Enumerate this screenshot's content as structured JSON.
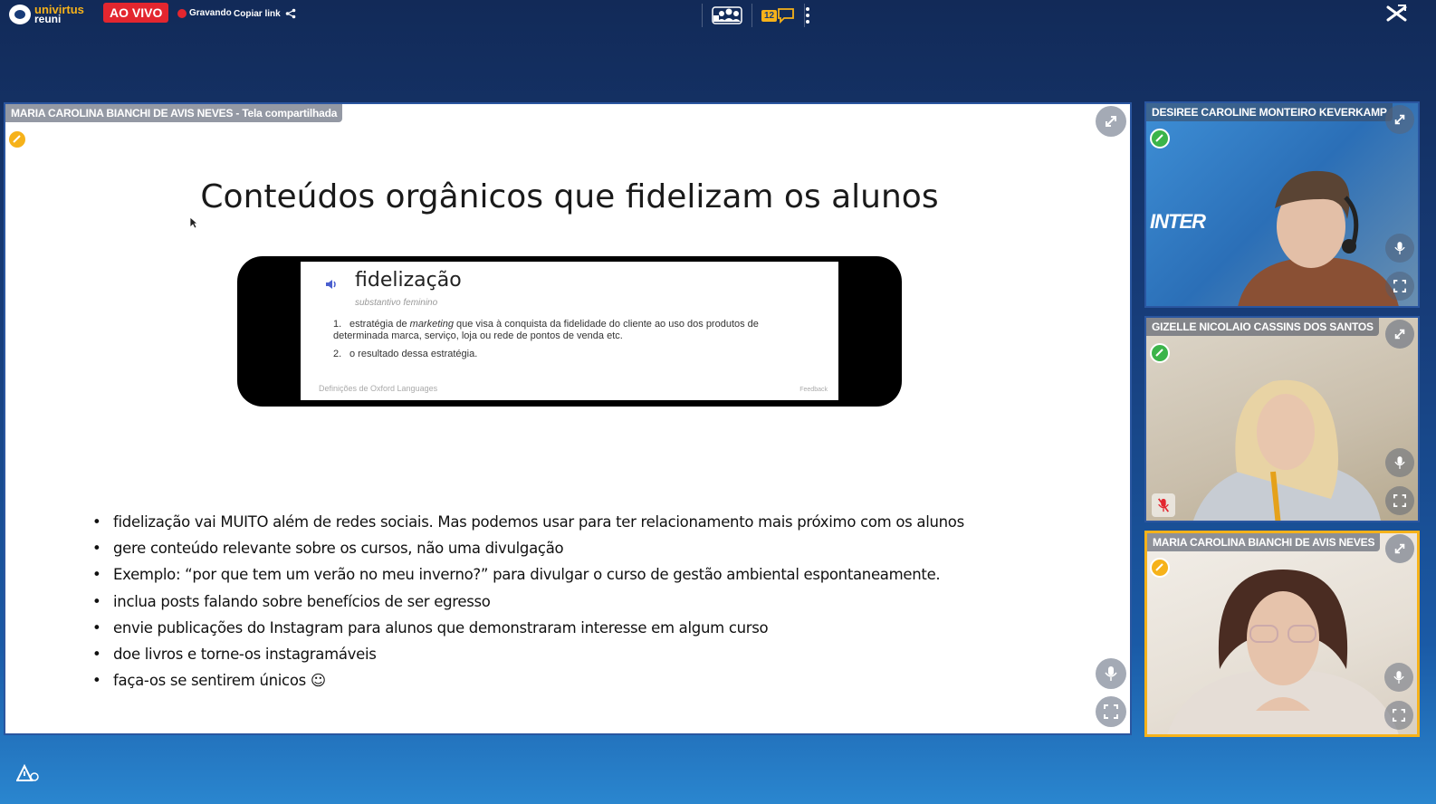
{
  "app": {
    "logo_line1": "univirtus",
    "logo_line2": "reuni",
    "live_label": "AO VIVO",
    "recording_label": "Gravando",
    "copy_link_label": "Copiar link",
    "chat_count": "12"
  },
  "main": {
    "label": "MARIA CAROLINA BIANCHI DE AVIS NEVES - Tela compartilhada",
    "slide_title": "Conteúdos orgânicos que fidelizam os alunos",
    "dictionary": {
      "word": "fidelização",
      "type": "substantivo feminino",
      "def1_num": "1.",
      "def1_pre": "estratégia de ",
      "def1_em": "marketing",
      "def1_post": " que visa à conquista da fidelidade do cliente ao uso dos produtos de determinada marca, serviço, loja ou rede de pontos de venda etc.",
      "def2_num": "2.",
      "def2": "o resultado dessa estratégia.",
      "source": "Definições de Oxford Languages",
      "feedback": "Feedback"
    },
    "bullets": [
      "fidelização vai MUITO além de redes sociais. Mas podemos usar para ter relacionamento mais próximo com os alunos",
      "gere conteúdo relevante sobre os cursos, não uma divulgação",
      "Exemplo: “por que tem um verão no meu inverno?” para divulgar o curso de gestão ambiental espontaneamente.",
      "inclua posts falando sobre benefícios de ser egresso",
      "envie publicações do Instagram para alunos que demonstraram interesse em algum curso",
      "doe livros e torne-os instagramáveis",
      "faça-os se sentirem únicos ☺"
    ]
  },
  "participants": [
    {
      "name": "DESIREE CAROLINE MONTEIRO KEVERKAMP",
      "status_color": "#3bb44a",
      "background_logo": "INTER"
    },
    {
      "name": "GIZELLE NICOLAIO CASSINS DOS SANTOS",
      "status_color": "#3bb44a"
    },
    {
      "name": "MARIA CAROLINA BIANCHI DE AVIS NEVES",
      "status_color": "#f6b21a"
    }
  ],
  "colors": {
    "live_red": "#e3262f",
    "accent_yellow": "#f6b21a",
    "online_green": "#3bb44a",
    "tile_border": "#2a56a0"
  }
}
